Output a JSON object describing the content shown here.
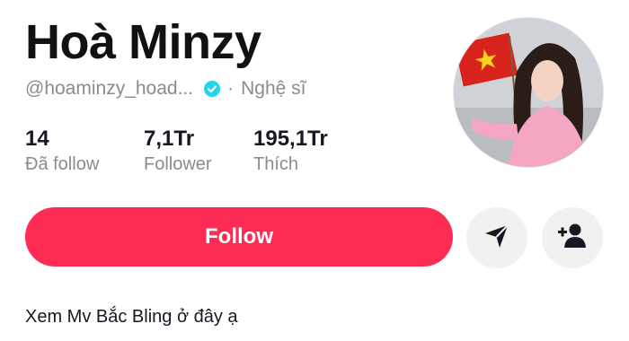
{
  "profile": {
    "display_name": "Hoà Minzy",
    "handle": "@hoaminzy_hoad...",
    "verified": true,
    "separator": "·",
    "role": "Nghệ sĩ",
    "bio": "Xem Mv Bắc Bling ở đây ạ"
  },
  "stats": [
    {
      "value": "14",
      "label": "Đã follow"
    },
    {
      "value": "7,1Tr",
      "label": "Follower"
    },
    {
      "value": "195,1Tr",
      "label": "Thích"
    }
  ],
  "actions": {
    "follow_label": "Follow",
    "message_icon": "send-icon",
    "suggest_icon": "add-user-icon"
  },
  "colors": {
    "accent": "#fe2c55",
    "verified": "#20d5ec",
    "secondary_text": "#8a8b91",
    "button_gray": "#f1f1f2"
  }
}
